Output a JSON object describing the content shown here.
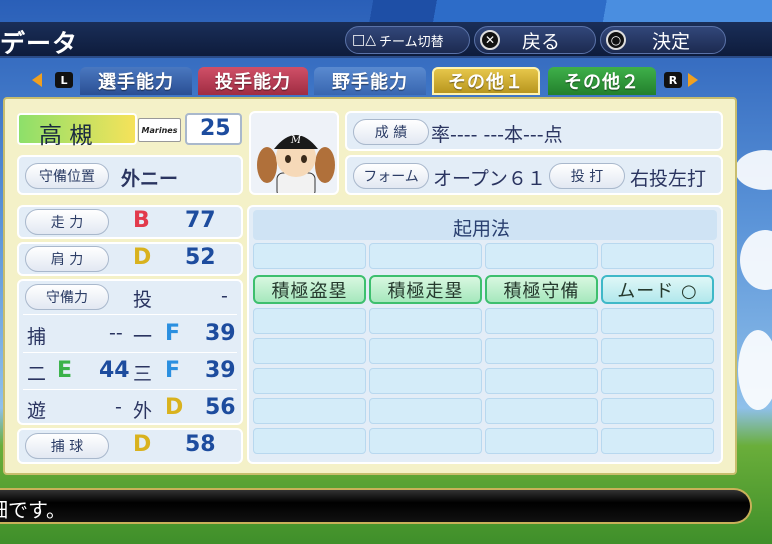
{
  "header": {
    "title": "データ",
    "team_switch": "チーム切替",
    "back": "戻る",
    "confirm": "決定",
    "team_switch_btn": "□△",
    "back_btn": "✕",
    "confirm_btn": "○"
  },
  "tabs": [
    {
      "label": "選手能力",
      "color": "#2f5fa8"
    },
    {
      "label": "投手能力",
      "color": "#b8384c"
    },
    {
      "label": "野手能力",
      "color": "#3a6eb8"
    },
    {
      "label": "その他１",
      "color": "#c9a82a",
      "active": true
    },
    {
      "label": "その他２",
      "color": "#2f9a3a"
    }
  ],
  "keys": {
    "left": "L",
    "right": "R"
  },
  "player": {
    "name": "高 槻",
    "team_logo": "Marines",
    "number": "25",
    "position_label": "守備位置",
    "position_value": "外ニー",
    "stats_label": "成 績",
    "stats_value": "率---- ---本---点",
    "form_label": "フォーム",
    "form_value": "オープン６１",
    "bat_label": "投 打",
    "bat_value": "右投左打"
  },
  "abilities": {
    "run_label": "走 力",
    "run_grade": "B",
    "run_value": "77",
    "arm_label": "肩 力",
    "arm_grade": "D",
    "arm_value": "52",
    "def_label": "守備力",
    "pitcher_pos": "投",
    "pitcher_val": "-",
    "catcher_pos": "捕",
    "catcher_val": "--",
    "first_pos": "一",
    "first_grade": "F",
    "first_val": "39",
    "second_pos": "二",
    "second_grade": "E",
    "second_val": "44",
    "third_pos": "三",
    "third_grade": "F",
    "third_val": "39",
    "short_pos": "遊",
    "short_val": "-",
    "outfield_pos": "外",
    "outfield_grade": "D",
    "outfield_val": "56",
    "catch_label": "捕 球",
    "catch_grade": "D",
    "catch_value": "58"
  },
  "usage": {
    "title": "起用法",
    "skills": [
      "積極盗塁",
      "積極走塁",
      "積極守備",
      "ムード ○"
    ]
  },
  "message": "細です。",
  "colors": {
    "grade_B": "#e23a4c",
    "grade_D": "#d9b21e",
    "grade_E": "#3bb24a",
    "grade_F": "#2a8fe0"
  }
}
